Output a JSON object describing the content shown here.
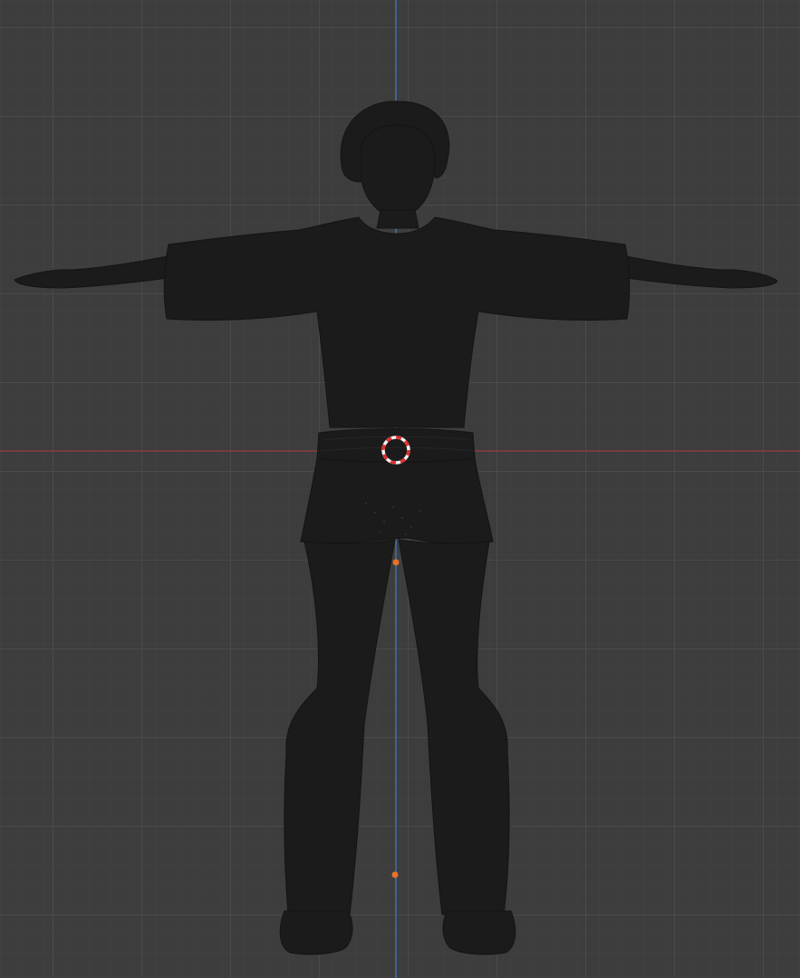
{
  "viewport": {
    "view": "front-orthographic",
    "background_color": "#3d3d3d",
    "grid_minor_color": "#454545",
    "grid_major_color": "#4f4f4f",
    "axis_x_color": "#8f3b40",
    "axis_z_color": "#3f6ea6",
    "model_color": "#1b1b1b",
    "cursor_primary_color": "#e03030",
    "cursor_secondary_color": "#f2f2f2",
    "origin_dot_color": "#e8712a",
    "grid_visible": true
  },
  "icons": {
    "character": "t-pose-character-mesh",
    "cursor": "3d-cursor-icon",
    "origin": "object-origin-dot"
  }
}
